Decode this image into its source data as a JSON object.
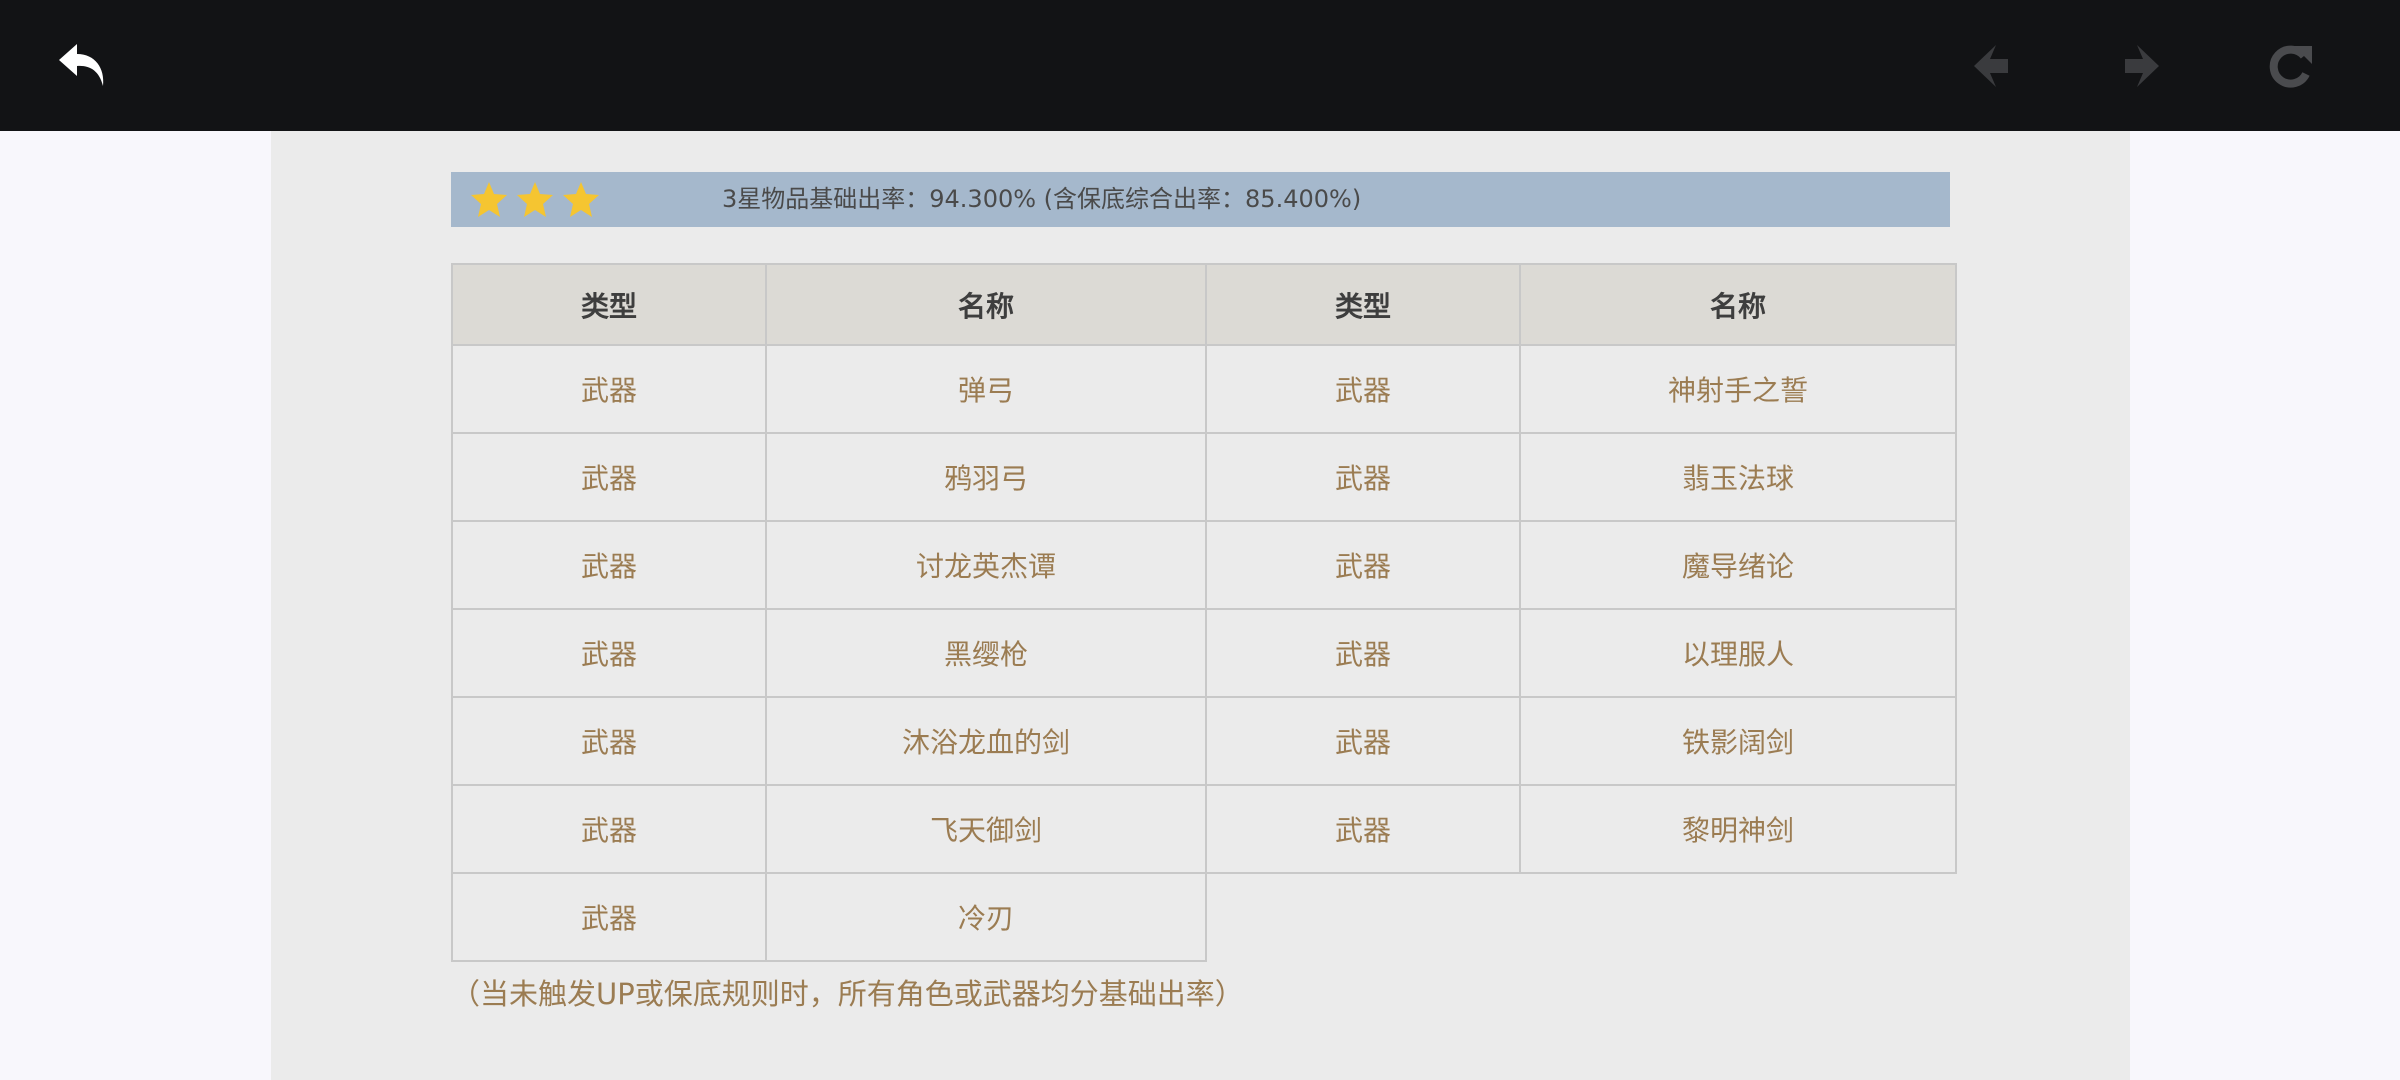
{
  "toolbar": {
    "back_icon": "back-arrow-icon",
    "prev_icon": "prev-icon",
    "next_icon": "next-icon",
    "refresh_icon": "refresh-icon"
  },
  "rate_bar": {
    "stars": 3,
    "star_color": "#f5c531",
    "text": "3星物品基础出率：94.300% (含保底综合出率：85.400%)"
  },
  "table": {
    "headers": [
      "类型",
      "名称",
      "类型",
      "名称"
    ],
    "rows": [
      [
        "武器",
        "弹弓",
        "武器",
        "神射手之誓"
      ],
      [
        "武器",
        "鸦羽弓",
        "武器",
        "翡玉法球"
      ],
      [
        "武器",
        "讨龙英杰谭",
        "武器",
        "魔导绪论"
      ],
      [
        "武器",
        "黑缨枪",
        "武器",
        "以理服人"
      ],
      [
        "武器",
        "沐浴龙血的剑",
        "武器",
        "铁影阔剑"
      ],
      [
        "武器",
        "飞天御剑",
        "武器",
        "黎明神剑"
      ],
      [
        "武器",
        "冷刃"
      ]
    ]
  },
  "footnote": "（当未触发UP或保底规则时，所有角色或武器均分基础出率）",
  "colors": {
    "topbar": "#121315",
    "content_bg": "#ebebeb",
    "rate_bar": "#a5b8cc",
    "header_bg": "#dcdad5",
    "cell_text": "#9b7c52"
  }
}
